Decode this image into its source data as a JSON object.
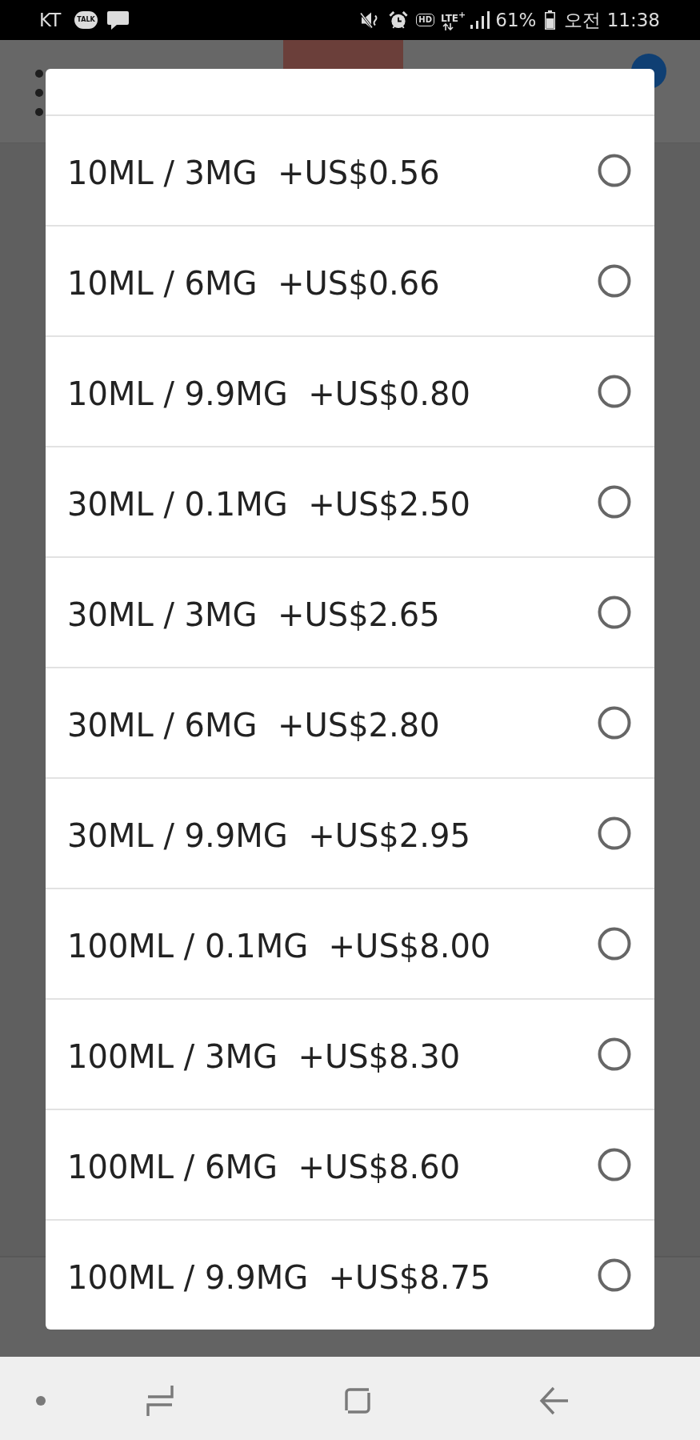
{
  "status_bar": {
    "carrier": "KT",
    "talk_badge": "TALK",
    "hd_badge": "HD",
    "network": "LTE$^{+}$",
    "battery": "61%",
    "time": "오전 11:38"
  },
  "dialog": {
    "options": [
      {
        "label": "10ML / 3MG  +US$0.56",
        "selected": false
      },
      {
        "label": "10ML / 6MG  +US$0.66",
        "selected": false
      },
      {
        "label": "10ML / 9.9MG  +US$0.80",
        "selected": false
      },
      {
        "label": "30ML / 0.1MG  +US$2.50",
        "selected": false
      },
      {
        "label": "30ML / 3MG  +US$2.65",
        "selected": false
      },
      {
        "label": "30ML / 6MG  +US$2.80",
        "selected": false
      },
      {
        "label": "30ML / 9.9MG  +US$2.95",
        "selected": false
      },
      {
        "label": "100ML / 0.1MG  +US$8.00",
        "selected": false
      },
      {
        "label": "100ML / 3MG  +US$8.30",
        "selected": false
      },
      {
        "label": "100ML / 6MG  +US$8.60",
        "selected": false
      },
      {
        "label": "100ML / 9.9MG  +US$8.75",
        "selected": false
      }
    ]
  }
}
